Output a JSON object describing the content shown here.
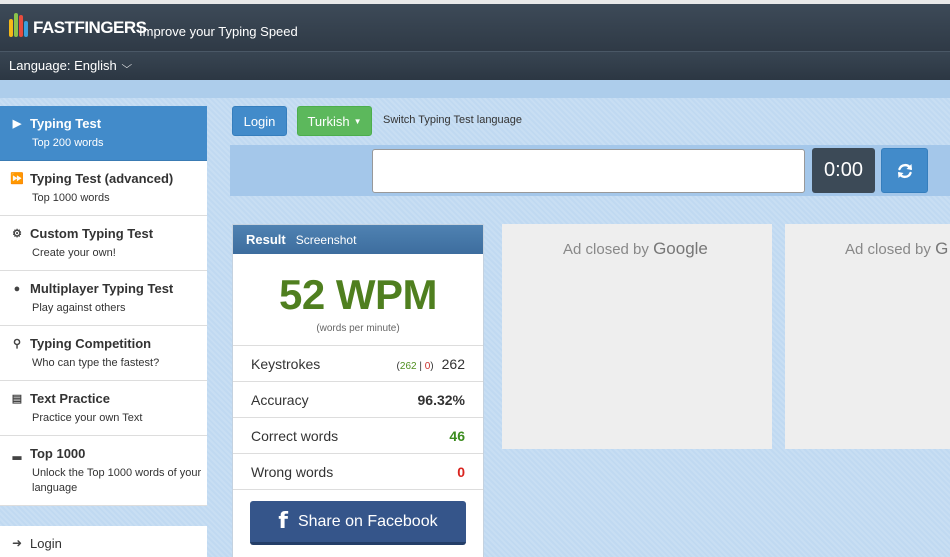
{
  "header": {
    "logo_prefix": "10",
    "logo_fast": "FAST",
    "logo_fingers": "FINGERS",
    "slogan": "Improve your Typing Speed"
  },
  "language_bar": {
    "label": "Language: English"
  },
  "sidebar": {
    "items": [
      {
        "title": "Typing Test",
        "subtitle": "Top 200 words",
        "icon": "play-icon",
        "active": true
      },
      {
        "title": "Typing Test (advanced)",
        "subtitle": "Top 1000 words",
        "icon": "fast-forward-icon"
      },
      {
        "title": "Custom Typing Test",
        "subtitle": "Create your own!",
        "icon": "cogs-icon"
      },
      {
        "title": "Multiplayer Typing Test",
        "subtitle": "Play against others",
        "icon": "users-icon"
      },
      {
        "title": "Typing Competition",
        "subtitle": "Who can type the fastest?",
        "icon": "trophy-icon"
      },
      {
        "title": "Text Practice",
        "subtitle": "Practice your own Text",
        "icon": "document-icon"
      },
      {
        "title": "Top 1000",
        "subtitle": "Unlock the Top 1000 words of your language",
        "icon": "signal-icon"
      }
    ],
    "login_label": "Login"
  },
  "controls": {
    "login_button": "Login",
    "language_button": "Turkish",
    "switch_label": "Switch Typing Test language",
    "timer": "0:00"
  },
  "result": {
    "tab_result": "Result",
    "tab_screenshot": "Screenshot",
    "wpm": "52 WPM",
    "wpm_sub": "(words per minute)",
    "keystrokes_label": "Keystrokes",
    "keystrokes_correct": "262",
    "keystrokes_wrong": "0",
    "keystrokes_total": "262",
    "accuracy_label": "Accuracy",
    "accuracy_value": "96.32%",
    "correct_label": "Correct words",
    "correct_value": "46",
    "wrong_label": "Wrong words",
    "wrong_value": "0",
    "facebook_button": "Share on Facebook"
  },
  "ads": {
    "ad1_text": "Ad closed by",
    "ad1_brand": "Google",
    "ad2_text": "Ad closed by",
    "ad2_brand": "G"
  },
  "colors": {
    "active_blue": "#428bca",
    "green_button": "#5cb85c",
    "wpm_green": "#4f7f1f",
    "facebook_blue": "#35558a"
  }
}
